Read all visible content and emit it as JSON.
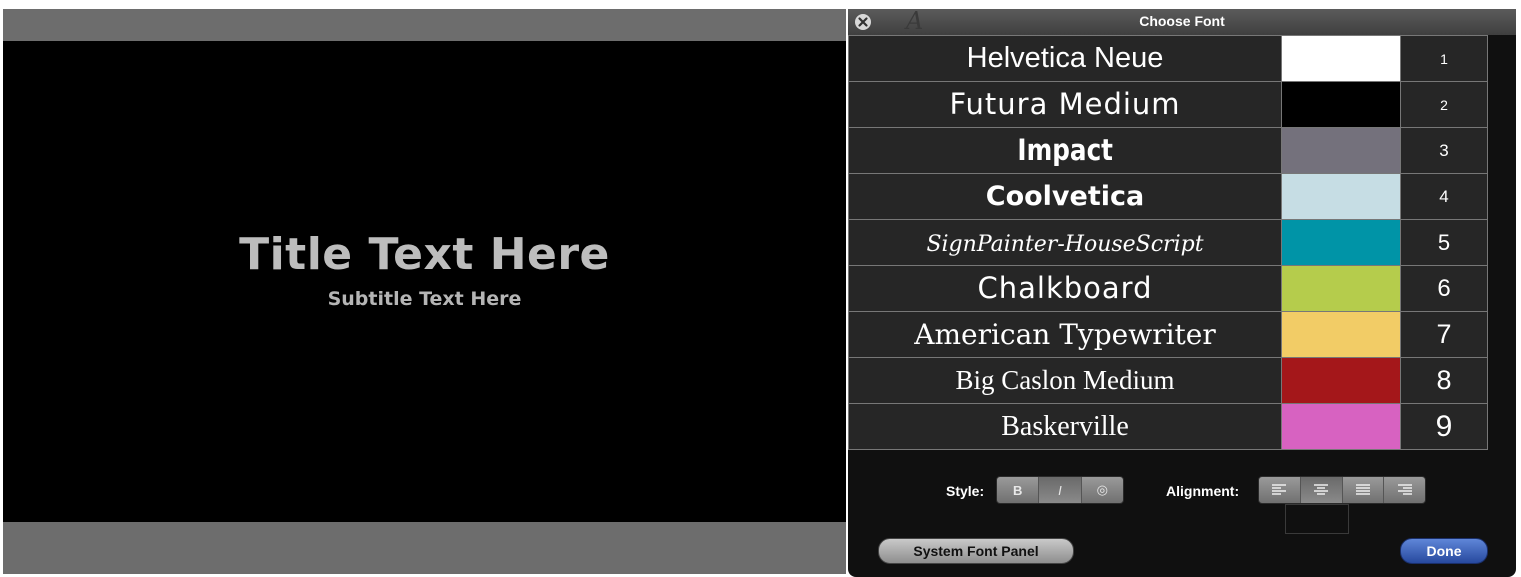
{
  "canvas": {
    "title": "Title Text Here",
    "subtitle": "Subtitle Text Here"
  },
  "panel": {
    "title": "Choose Font",
    "close_icon": "close-circle-icon",
    "fonts": [
      {
        "name": "Helvetica Neue",
        "color": "#ffffff",
        "number": "1"
      },
      {
        "name": "Futura Medium",
        "color": "#000000",
        "number": "2"
      },
      {
        "name": "Impact",
        "color": "#74717c",
        "number": "3"
      },
      {
        "name": "Coolvetica",
        "color": "#c6dde4",
        "number": "4"
      },
      {
        "name": "SignPainter-HouseScript",
        "color": "#0094a7",
        "number": "5"
      },
      {
        "name": "Chalkboard",
        "color": "#b5cc4c",
        "number": "6"
      },
      {
        "name": "American Typewriter",
        "color": "#f2cc66",
        "number": "7"
      },
      {
        "name": "Big Caslon Medium",
        "color": "#a4171a",
        "number": "8"
      },
      {
        "name": "Baskerville",
        "color": "#d762c1",
        "number": "9"
      }
    ],
    "style_label": "Style:",
    "style_buttons": [
      "B",
      "I",
      "◎"
    ],
    "alignment_label": "Alignment:",
    "alignment_buttons": [
      "align-left-icon",
      "align-center-icon",
      "align-justify-icon",
      "align-right-icon"
    ],
    "system_font_button": "System Font Panel",
    "done_button": "Done"
  }
}
